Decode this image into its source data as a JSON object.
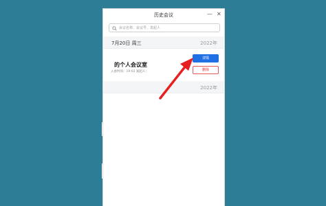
{
  "window": {
    "title": "历史会议",
    "minimize": "—",
    "close": "✕"
  },
  "search": {
    "placeholder": "会议名称、会议号、发起人"
  },
  "groups": [
    {
      "date": "7月20日 周三",
      "year": "2022年"
    },
    {
      "date": "",
      "year": "2022年"
    }
  ],
  "meeting": {
    "name": "的个人会议室",
    "meta": "入会时间：19:02  发起人：",
    "detail_label": "详情",
    "delete_label": "删除"
  },
  "colors": {
    "background": "#2e7d96",
    "primary_button": "#1f6fe5",
    "danger": "#e13c3c",
    "annotation_arrow": "#e62020"
  },
  "icons": {
    "search": "search-icon",
    "annotation": "red-arrow-annotation"
  }
}
